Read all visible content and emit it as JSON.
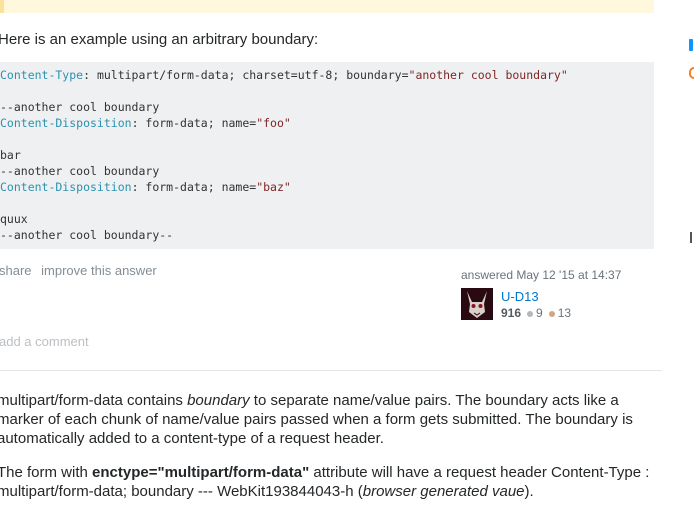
{
  "answer": {
    "intro": "Here is an example using an arbitrary boundary:",
    "code_lines": [
      {
        "parts": [
          [
            "k2",
            "Content-Type"
          ],
          [
            "p",
            ": multipart/form-data; charset=utf-8; boundary="
          ],
          [
            "s",
            "\"another cool boundary\""
          ]
        ]
      },
      {
        "parts": [
          [
            "p",
            ""
          ]
        ]
      },
      {
        "parts": [
          [
            "p",
            "--another cool boundary"
          ]
        ]
      },
      {
        "parts": [
          [
            "k2",
            "Content-Disposition"
          ],
          [
            "p",
            ": form-data; name="
          ],
          [
            "s",
            "\"foo\""
          ]
        ]
      },
      {
        "parts": [
          [
            "p",
            ""
          ]
        ]
      },
      {
        "parts": [
          [
            "p",
            "bar"
          ]
        ]
      },
      {
        "parts": [
          [
            "p",
            "--another cool boundary"
          ]
        ]
      },
      {
        "parts": [
          [
            "k2",
            "Content-Disposition"
          ],
          [
            "p",
            ": form-data; name="
          ],
          [
            "s",
            "\"baz\""
          ]
        ]
      },
      {
        "parts": [
          [
            "p",
            ""
          ]
        ]
      },
      {
        "parts": [
          [
            "p",
            "quux"
          ]
        ]
      },
      {
        "parts": [
          [
            "p",
            "--another cool boundary--"
          ]
        ]
      }
    ],
    "menu": {
      "share": "share",
      "improve": "improve this answer"
    },
    "user_card": {
      "action": "answered May 12 '15 at 14:37",
      "name": "U-D13",
      "reputation": "916",
      "silver": "9",
      "bronze": "13",
      "silver_color": "#b4b8bc",
      "bronze_color": "#d1a684"
    },
    "add_comment": "add a comment"
  },
  "second_answer": {
    "p1_pre": "multipart/form-data contains ",
    "p1_em": "boundary",
    "p1_post": " to separate name/value pairs. The boundary acts like a marker of each chunk of name/value pairs passed when a form gets submitted. The boundary is automatically added to a content-type of a request header.",
    "p2_pre": "The form with ",
    "p2_strong": "enctype=\"multipart/form-data\"",
    "p2_mid": " attribute will have a request header Content-Type : multipart/form-data; boundary --- WebKit193844043-h (",
    "p2_em": "browser generated vaue",
    "p2_post": ")."
  }
}
